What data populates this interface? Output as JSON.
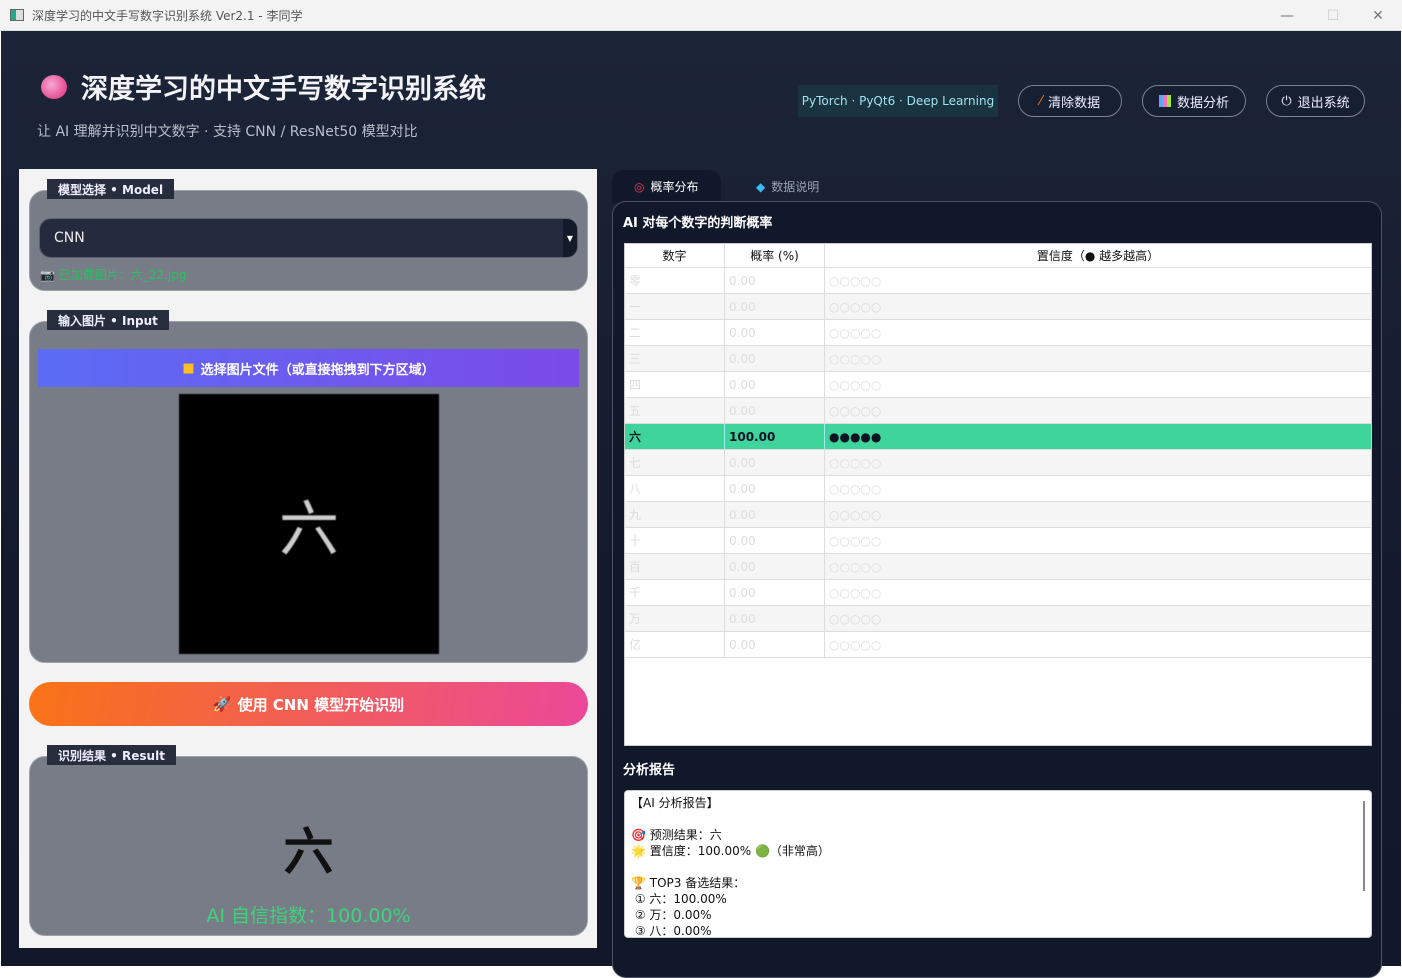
{
  "window": {
    "title": "深度学习的中文手写数字识别系统 Ver2.1 - 李同学",
    "minimize": "—",
    "maximize": "☐",
    "close": "✕"
  },
  "header": {
    "icon": "brain-icon",
    "title": "深度学习的中文手写数字识别系统",
    "subtitle": "让 AI 理解并识别中文数字 · 支持 CNN / ResNet50 模型对比",
    "tagline": "PyTorch · PyQt6 · Deep Learning",
    "buttons": [
      {
        "icon": "broom-icon",
        "label": "清除数据"
      },
      {
        "icon": "bar-chart-icon",
        "label": "数据分析"
      },
      {
        "icon": "power-icon",
        "label": "退出系统"
      }
    ]
  },
  "model": {
    "label": "模型选择 • Model",
    "selected": "CNN",
    "loaded_icon": "camera-icon",
    "loaded": "已加载图片：六_22.jpg"
  },
  "input": {
    "label": "输入图片 • Input",
    "pick_button": "选择图片文件（或直接拖拽到下方区域）",
    "preview_char": "六"
  },
  "run_button": "使用 CNN 模型开始识别",
  "result": {
    "label": "识别结果 • Result",
    "char": "六",
    "confidence": "AI 自信指数：100.00%"
  },
  "tabs": [
    {
      "icon": "target-icon",
      "label": "概率分布",
      "active": true
    },
    {
      "icon": "gem-icon",
      "label": "数据说明",
      "active": false
    }
  ],
  "prob": {
    "title": "AI 对每个数字的判断概率",
    "headers": [
      "数字",
      "概率 (%)",
      "置信度（● 越多越高）"
    ],
    "rows": [
      [
        "零",
        "0.00",
        "○○○○○"
      ],
      [
        "一",
        "0.00",
        "○○○○○"
      ],
      [
        "二",
        "0.00",
        "○○○○○"
      ],
      [
        "三",
        "0.00",
        "○○○○○"
      ],
      [
        "四",
        "0.00",
        "○○○○○"
      ],
      [
        "五",
        "0.00",
        "○○○○○"
      ],
      [
        "六",
        "100.00",
        "●●●●●"
      ],
      [
        "七",
        "0.00",
        "○○○○○"
      ],
      [
        "八",
        "0.00",
        "○○○○○"
      ],
      [
        "九",
        "0.00",
        "○○○○○"
      ],
      [
        "十",
        "0.00",
        "○○○○○"
      ],
      [
        "百",
        "0.00",
        "○○○○○"
      ],
      [
        "千",
        "0.00",
        "○○○○○"
      ],
      [
        "万",
        "0.00",
        "○○○○○"
      ],
      [
        "亿",
        "0.00",
        "○○○○○"
      ]
    ],
    "highlight_color": "#3ed49c"
  },
  "report": {
    "title": "分析报告",
    "lines": [
      "【AI 分析报告】",
      "",
      "🎯 预测结果：六",
      "🌟 置信度：100.00% 🟢（非常高）",
      "",
      "🏆 TOP3 备选结果：",
      " ① 六：100.00%",
      " ② 万：0.00%",
      " ③ 八：0.00%"
    ]
  }
}
